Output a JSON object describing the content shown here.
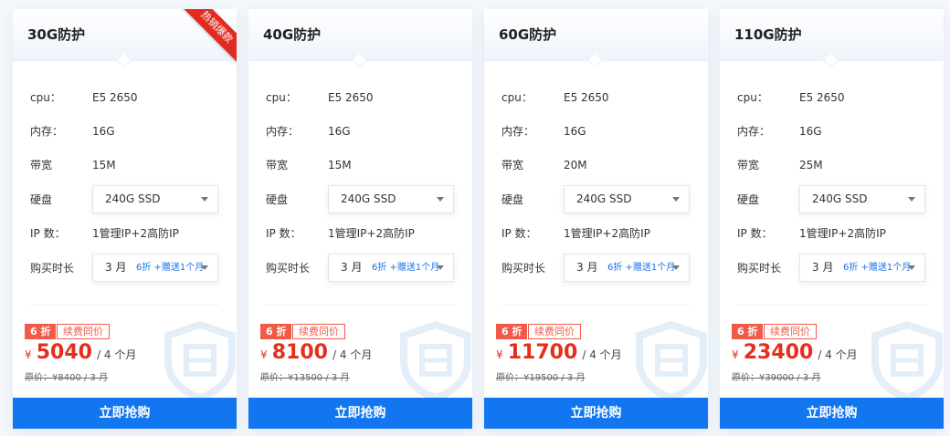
{
  "labels": {
    "cpu": "cpu：",
    "memory": "内存：",
    "bandwidth": "带宽",
    "disk": "硬盘",
    "ip": "IP 数：",
    "duration": "购买时长",
    "renew_tag": "续费同价",
    "buy": "立即抢购",
    "currency": "¥"
  },
  "cards": [
    {
      "title": "30G防护",
      "ribbon": "热销爆款",
      "cpu": "E5 2650",
      "memory": "16G",
      "bandwidth": "15M",
      "disk": "240G SSD",
      "ip": "1管理IP+2高防IP",
      "duration": "3 月",
      "duration_promo": "6折 +赠送1个月",
      "discount": "6 折",
      "price": "5040",
      "period": "/ 4 个月",
      "original": "原价：¥8400 / 3 月"
    },
    {
      "title": "40G防护",
      "ribbon": "",
      "cpu": "E5 2650",
      "memory": "16G",
      "bandwidth": "15M",
      "disk": "240G SSD",
      "ip": "1管理IP+2高防IP",
      "duration": "3 月",
      "duration_promo": "6折 +赠送1个月",
      "discount": "6 折",
      "price": "8100",
      "period": "/ 4 个月",
      "original": "原价：¥13500 / 3 月"
    },
    {
      "title": "60G防护",
      "ribbon": "",
      "cpu": "E5 2650",
      "memory": "16G",
      "bandwidth": "20M",
      "disk": "240G SSD",
      "ip": "1管理IP+2高防IP",
      "duration": "3 月",
      "duration_promo": "6折 +赠送1个月",
      "discount": "6 折",
      "price": "11700",
      "period": "/ 4 个月",
      "original": "原价：¥19500 / 3 月"
    },
    {
      "title": "110G防护",
      "ribbon": "",
      "cpu": "E5 2650",
      "memory": "16G",
      "bandwidth": "25M",
      "disk": "240G SSD",
      "ip": "1管理IP+2高防IP",
      "duration": "3 月",
      "duration_promo": "6折 +赠送1个月",
      "discount": "6 折",
      "price": "23400",
      "period": "/ 4 个月",
      "original": "原价：¥39000 / 3 月"
    }
  ],
  "colors": {
    "accent": "#1276f0",
    "price": "#e52e1c",
    "ribbon": "#e02b1e",
    "tag": "#f05a47"
  },
  "icons": {
    "watermark": "shield-icon",
    "dropdown": "chevron-down-icon"
  }
}
